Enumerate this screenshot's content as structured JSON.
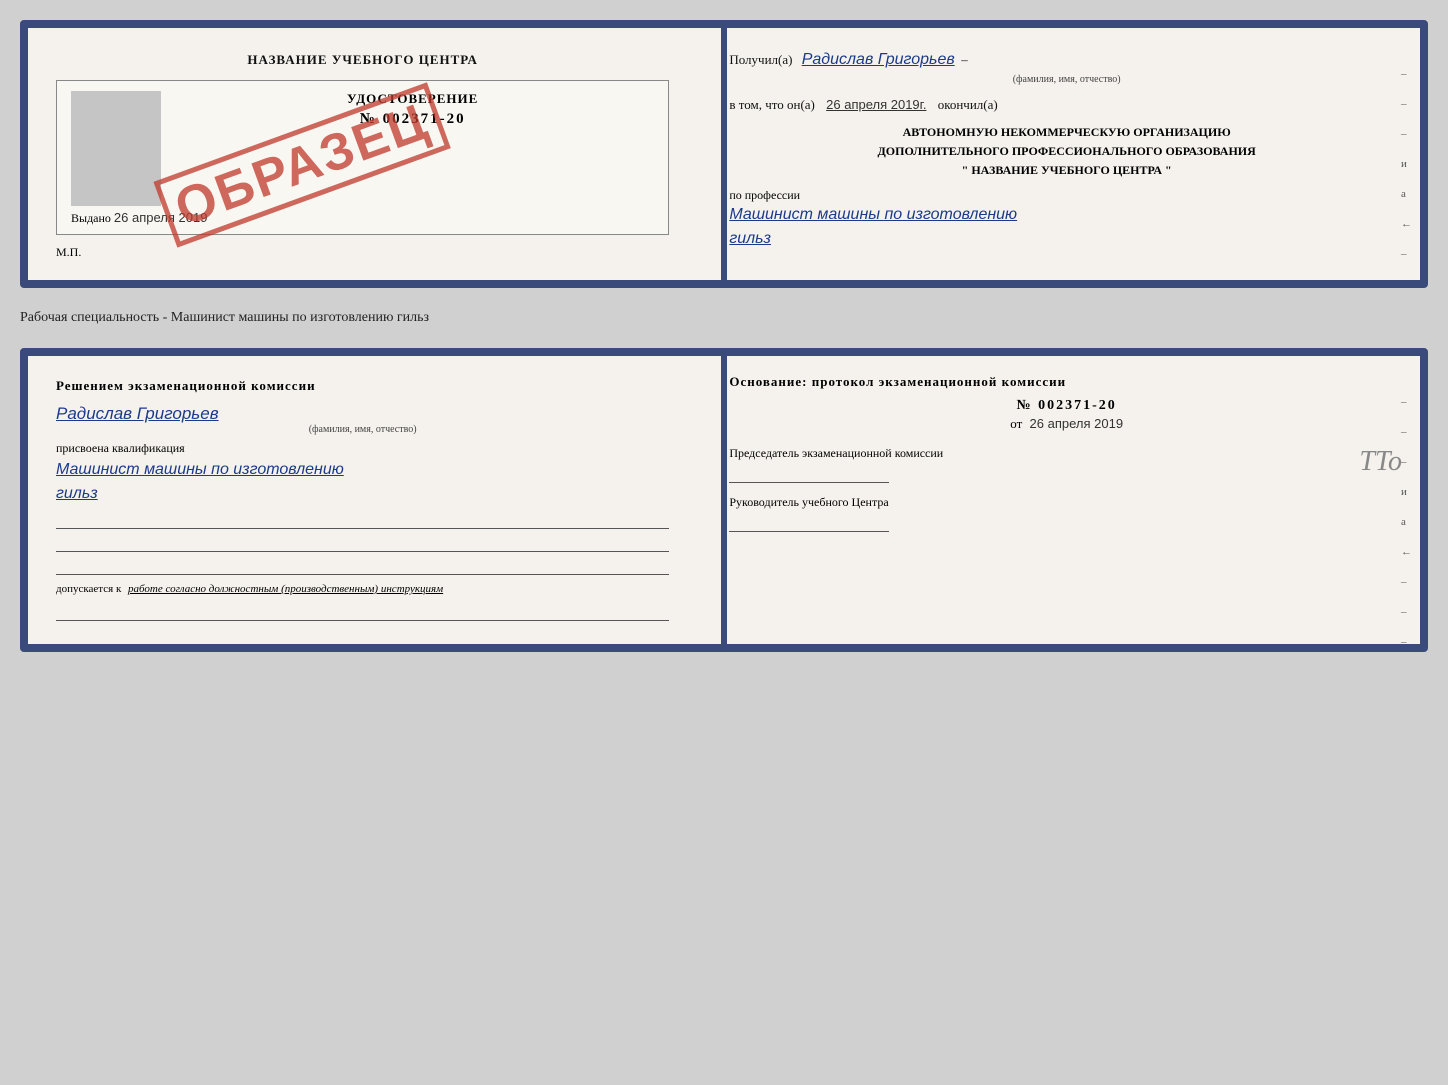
{
  "top_card": {
    "left": {
      "center_title": "НАЗВАНИЕ УЧЕБНОГО ЦЕНТРА",
      "cert_title": "УДОСТОВЕРЕНИЕ",
      "cert_number": "№ 002371-20",
      "stamp": "ОБРАЗЕЦ",
      "issued_label": "Выдано",
      "issued_date": "26 апреля 2019",
      "mp_label": "М.П."
    },
    "right": {
      "received_label": "Получил(а)",
      "recipient_name": "Радислав Григорьев",
      "fio_label": "(фамилия, имя, отчество)",
      "date_label": "в том, что он(а)",
      "date_value": "26 апреля 2019г.",
      "finished_label": "окончил(а)",
      "org_line1": "АВТОНОМНУЮ НЕКОММЕРЧЕСКУЮ ОРГАНИЗАЦИЮ",
      "org_line2": "ДОПОЛНИТЕЛЬНОГО ПРОФЕССИОНАЛЬНОГО ОБРАЗОВАНИЯ",
      "org_line3": "\"  НАЗВАНИЕ УЧЕБНОГО ЦЕНТРА  \"",
      "profession_label": "по профессии",
      "profession_value": "Машинист машины по изготовлению",
      "profession_value2": "гильз",
      "side_dashes": [
        "–",
        "–",
        "–",
        "и",
        "а",
        "←",
        "–",
        "–",
        "–"
      ]
    }
  },
  "between_label": "Рабочая специальность - Машинист машины по изготовлению гильз",
  "bottom_card": {
    "left": {
      "decision_title": "Решением  экзаменационной  комиссии",
      "name": "Радислав Григорьев",
      "fio_label": "(фамилия, имя, отчество)",
      "assigned_label": "присвоена квалификация",
      "qualification": "Машинист машины по изготовлению",
      "qualification2": "гильз",
      "допуск_prefix": "допускается к",
      "допуск_italic": "работе согласно должностным (производственным) инструкциям"
    },
    "right": {
      "osnov_title": "Основание: протокол экзаменационной  комиссии",
      "protocol_number": "№  002371-20",
      "date_prefix": "от",
      "date_value": "26 апреля 2019",
      "chairman_label": "Председатель экзаменационной комиссии",
      "head_label": "Руководитель учебного Центра",
      "side_dashes": [
        "–",
        "–",
        "–",
        "и",
        "а",
        "←",
        "–",
        "–",
        "–"
      ]
    }
  }
}
